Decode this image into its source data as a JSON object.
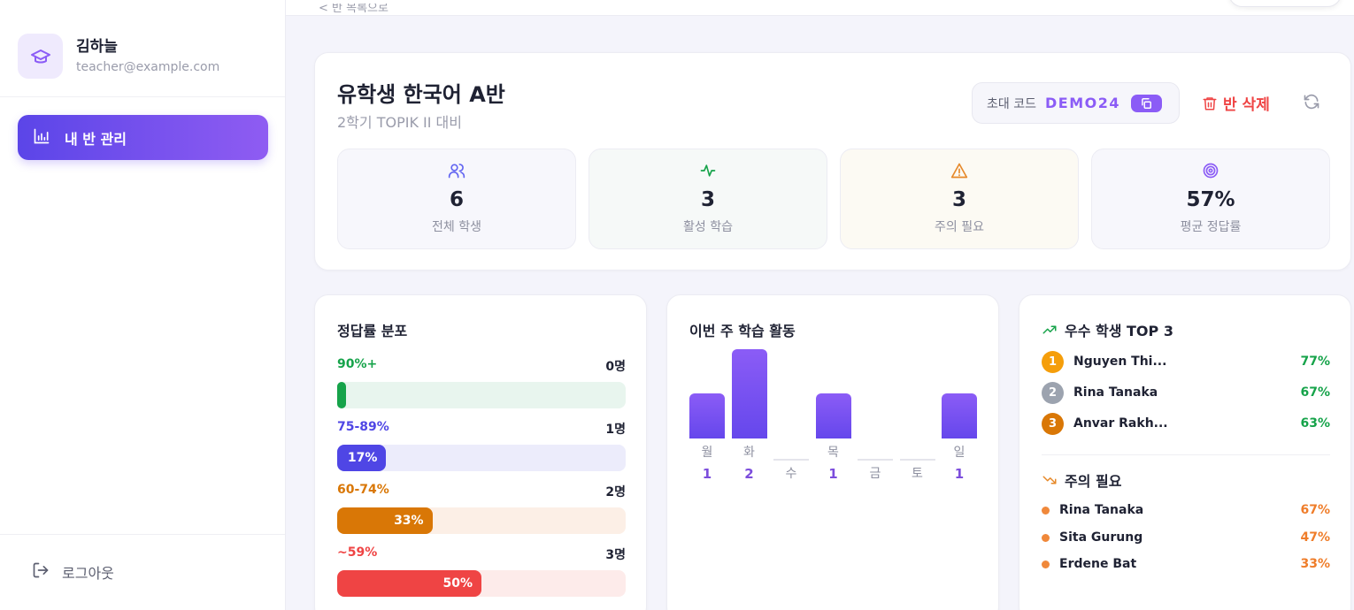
{
  "user": {
    "name": "김하늘",
    "email": "teacher@example.com"
  },
  "nav": {
    "active_label": "내 반 관리"
  },
  "logout_label": "로그아웃",
  "breadcrumb": "< 반 목록으로",
  "class": {
    "title": "유학생 한국어 A반",
    "subtitle": "2학기 TOPIK II 대비",
    "invite_label": "초대 코드",
    "invite_code": "DEMO24",
    "delete_label": "반 삭제"
  },
  "stats": [
    {
      "icon": "users-icon",
      "value": "6",
      "label": "전체 학생",
      "color": "#6366f1"
    },
    {
      "icon": "activity-icon",
      "value": "3",
      "label": "활성 학습",
      "color": "#16a34a"
    },
    {
      "icon": "warning-icon",
      "value": "3",
      "label": "주의 필요",
      "color": "#e6892a"
    },
    {
      "icon": "target-icon",
      "value": "57%",
      "label": "평균 정답률",
      "color": "#8b5cf6"
    }
  ],
  "distribution": {
    "title": "정답률 분포",
    "rows": [
      {
        "range": "90%+",
        "count": "0명",
        "percent": 0,
        "pct_label": "",
        "color": "#16a34a",
        "bg": "#e8f5ee",
        "text_color": "#16a34a"
      },
      {
        "range": "75-89%",
        "count": "1명",
        "percent": 17,
        "pct_label": "17%",
        "color": "#4f46e5",
        "bg": "#ececfb",
        "text_color": "#4f46e5"
      },
      {
        "range": "60-74%",
        "count": "2명",
        "percent": 33,
        "pct_label": "33%",
        "color": "#d97706",
        "bg": "#fcefe6",
        "text_color": "#d97706"
      },
      {
        "range": "~59%",
        "count": "3명",
        "percent": 50,
        "pct_label": "50%",
        "color": "#ef4444",
        "bg": "#fdebea",
        "text_color": "#ef4444"
      }
    ]
  },
  "activity": {
    "title": "이번 주 학습 활동",
    "days": [
      {
        "day": "월",
        "count": 1
      },
      {
        "day": "화",
        "count": 2
      },
      {
        "day": "수",
        "count": 0
      },
      {
        "day": "목",
        "count": 1
      },
      {
        "day": "금",
        "count": 0
      },
      {
        "day": "토",
        "count": 0
      },
      {
        "day": "일",
        "count": 1
      }
    ]
  },
  "top_students": {
    "title": "우수 학생 TOP 3",
    "items": [
      {
        "rank": "1",
        "name": "Nguyen Thi...",
        "pct": "77%",
        "medal_color": "#f59e0b"
      },
      {
        "rank": "2",
        "name": "Rina Tanaka",
        "pct": "67%",
        "medal_color": "#9ca3af"
      },
      {
        "rank": "3",
        "name": "Anvar Rakh...",
        "pct": "63%",
        "medal_color": "#d97706"
      }
    ]
  },
  "attention": {
    "title": "주의 필요",
    "items": [
      {
        "name": "Rina Tanaka",
        "pct": "67%"
      },
      {
        "name": "Sita Gurung",
        "pct": "47%"
      },
      {
        "name": "Erdene Bat",
        "pct": "33%"
      }
    ]
  }
}
